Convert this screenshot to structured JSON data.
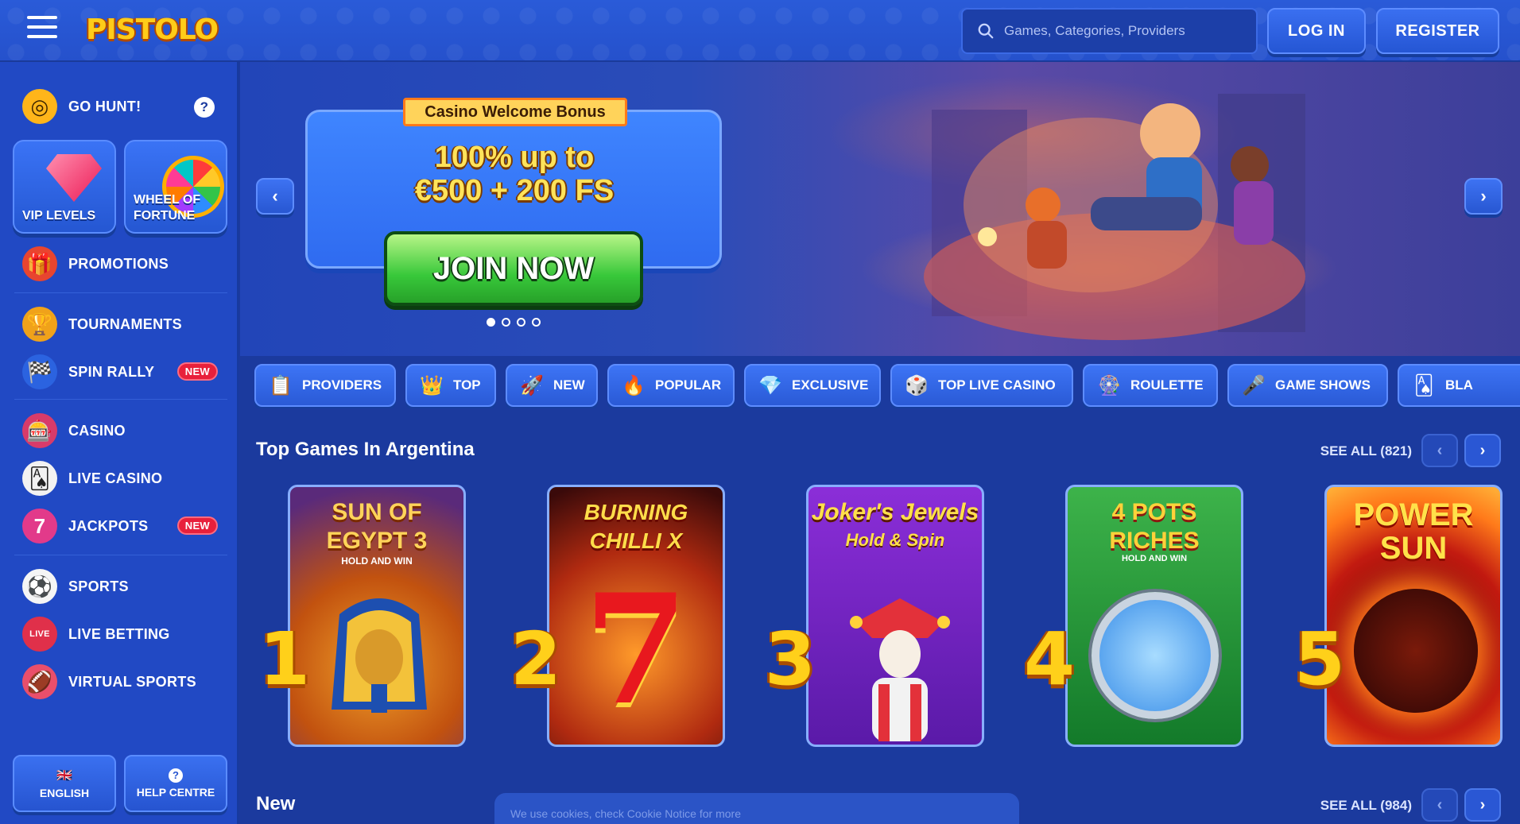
{
  "header": {
    "logo_text": "PISTOLO",
    "search_placeholder": "Games, Categories, Providers",
    "login_label": "LOG IN",
    "register_label": "REGISTER"
  },
  "sidebar": {
    "go_hunt": "GO HUNT!",
    "help_mark": "?",
    "tiles": [
      {
        "label": "VIP LEVELS"
      },
      {
        "label_line1": "WHEEL OF",
        "label_line2": "FORTUNE"
      }
    ],
    "items": [
      {
        "label": "PROMOTIONS",
        "icon": "gift-icon"
      },
      {
        "label": "TOURNAMENTS",
        "icon": "trophy-icon"
      },
      {
        "label": "SPIN RALLY",
        "icon": "checkered-flag-icon",
        "badge": "NEW"
      },
      {
        "label": "CASINO",
        "icon": "slot-machine-icon"
      },
      {
        "label": "LIVE CASINO",
        "icon": "cards-icon"
      },
      {
        "label": "JACKPOTS",
        "icon": "jackpot-seven-icon",
        "badge": "NEW"
      },
      {
        "label": "SPORTS",
        "icon": "soccer-ball-icon"
      },
      {
        "label": "LIVE BETTING",
        "icon": "live-icon"
      },
      {
        "label": "VIRTUAL SPORTS",
        "icon": "virtual-sports-icon"
      }
    ],
    "language_label": "ENGLISH",
    "help_centre_label": "HELP CENTRE"
  },
  "banner": {
    "tag": "Casino Welcome Bonus",
    "line1": "100% up to",
    "line2": "€500 + 200 FS",
    "cta": "JOIN NOW",
    "slides_total": 4,
    "active_slide": 1
  },
  "categories": [
    {
      "label": "PROVIDERS",
      "icon": "list-icon"
    },
    {
      "label": "TOP",
      "icon": "crown-icon"
    },
    {
      "label": "NEW",
      "icon": "rocket-icon"
    },
    {
      "label": "POPULAR",
      "icon": "flame-icon"
    },
    {
      "label": "EXCLUSIVE",
      "icon": "diamond-icon"
    },
    {
      "label": "TOP LIVE CASINO",
      "icon": "chip-icon"
    },
    {
      "label": "ROULETTE",
      "icon": "roulette-icon"
    },
    {
      "label": "GAME SHOWS",
      "icon": "microphone-icon"
    },
    {
      "label": "BLA",
      "icon": "blackjack-icon"
    }
  ],
  "top_section": {
    "title": "Top Games In Argentina",
    "see_all": "SEE ALL (821)",
    "games": [
      {
        "rank": "1",
        "title": "SUN OF EGYPT 3",
        "subtitle": "HOLD AND WIN"
      },
      {
        "rank": "2",
        "title": "BURNING CHILLI X"
      },
      {
        "rank": "3",
        "title": "Joker's Jewels",
        "subtitle": "Hold & Spin"
      },
      {
        "rank": "4",
        "title": "4 POTS RICHES",
        "subtitle": "HOLD AND WIN"
      },
      {
        "rank": "5",
        "title": "POWER SUN"
      }
    ]
  },
  "new_section": {
    "title": "New",
    "see_all": "SEE ALL (984)"
  },
  "cookie_notice": "We use cookies, check Cookie Notice for more"
}
